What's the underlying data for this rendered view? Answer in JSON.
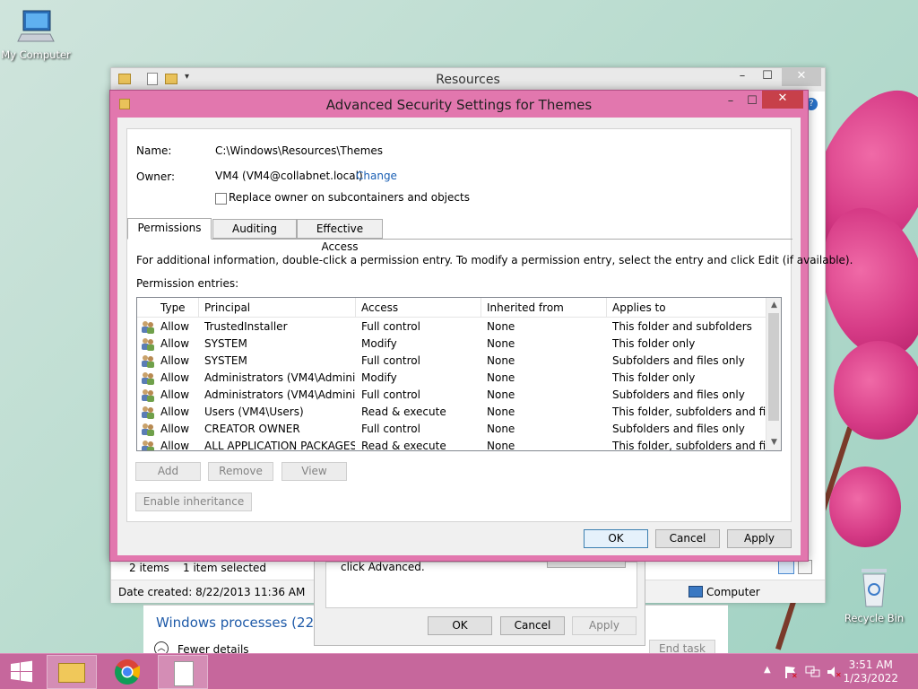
{
  "desktop": {
    "icons": [
      {
        "label": "My Computer"
      },
      {
        "label": "Recycle Bin"
      }
    ]
  },
  "explorer": {
    "title": "Resources",
    "status": {
      "items": "2 items",
      "selected": "1 item selected"
    },
    "details": {
      "date_created": "Date created: 8/22/2013 11:36 AM",
      "location": "Computer"
    }
  },
  "task_manager": {
    "section": "Windows processes (22)",
    "fewer_details": "Fewer details",
    "end_task": "End task"
  },
  "properties_dialog": {
    "text": "click Advanced.",
    "ok": "OK",
    "cancel": "Cancel",
    "apply": "Apply"
  },
  "dialog": {
    "title": "Advanced Security Settings for Themes",
    "name_label": "Name:",
    "name_value": "C:\\Windows\\Resources\\Themes",
    "owner_label": "Owner:",
    "owner_value": "VM4 (VM4@collabnet.local)",
    "change_link": "Change",
    "replace_owner_label": "Replace owner on subcontainers and objects",
    "tabs": [
      {
        "label": "Permissions"
      },
      {
        "label": "Auditing"
      },
      {
        "label": "Effective Access"
      }
    ],
    "info_text": "For additional information, double-click a permission entry. To modify a permission entry, select the entry and click Edit (if available).",
    "entries_label": "Permission entries:",
    "columns": [
      "Type",
      "Principal",
      "Access",
      "Inherited from",
      "Applies to"
    ],
    "rows": [
      {
        "type": "Allow",
        "principal": "TrustedInstaller",
        "access": "Full control",
        "inherited": "None",
        "applies": "This folder and subfolders"
      },
      {
        "type": "Allow",
        "principal": "SYSTEM",
        "access": "Modify",
        "inherited": "None",
        "applies": "This folder only"
      },
      {
        "type": "Allow",
        "principal": "SYSTEM",
        "access": "Full control",
        "inherited": "None",
        "applies": "Subfolders and files only"
      },
      {
        "type": "Allow",
        "principal": "Administrators (VM4\\Admini...",
        "access": "Modify",
        "inherited": "None",
        "applies": "This folder only"
      },
      {
        "type": "Allow",
        "principal": "Administrators (VM4\\Admini...",
        "access": "Full control",
        "inherited": "None",
        "applies": "Subfolders and files only"
      },
      {
        "type": "Allow",
        "principal": "Users (VM4\\Users)",
        "access": "Read & execute",
        "inherited": "None",
        "applies": "This folder, subfolders and files"
      },
      {
        "type": "Allow",
        "principal": "CREATOR OWNER",
        "access": "Full control",
        "inherited": "None",
        "applies": "Subfolders and files only"
      },
      {
        "type": "Allow",
        "principal": "ALL APPLICATION PACKAGES",
        "access": "Read & execute",
        "inherited": "None",
        "applies": "This folder, subfolders and files"
      }
    ],
    "buttons": {
      "add": "Add",
      "remove": "Remove",
      "view": "View",
      "enable_inheritance": "Enable inheritance",
      "ok": "OK",
      "cancel": "Cancel",
      "apply": "Apply"
    }
  },
  "taskbar": {
    "time": "3:51 AM",
    "date": "1/23/2022"
  },
  "colors": {
    "dialog_frame": "#e277ae",
    "taskbar": "#c6679c",
    "link": "#1a5fb4"
  }
}
